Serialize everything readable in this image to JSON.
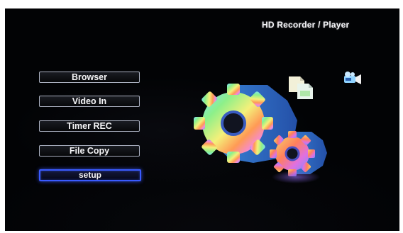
{
  "header": {
    "title": "HD Recorder / Player"
  },
  "menu": {
    "items": [
      {
        "label": "Browser",
        "selected": false
      },
      {
        "label": "Video In",
        "selected": false
      },
      {
        "label": "Timer REC",
        "selected": false
      },
      {
        "label": "File Copy",
        "selected": false
      },
      {
        "label": "setup",
        "selected": true
      }
    ]
  },
  "icons": {
    "main": "gears-settings-icon",
    "copy": "file-copy-icon",
    "camera": "video-camera-icon"
  },
  "colors": {
    "screen_bg": "#020305",
    "button_border": "#aab0c0",
    "selection_border": "#3a5bff",
    "text": "#f5f5f7"
  }
}
